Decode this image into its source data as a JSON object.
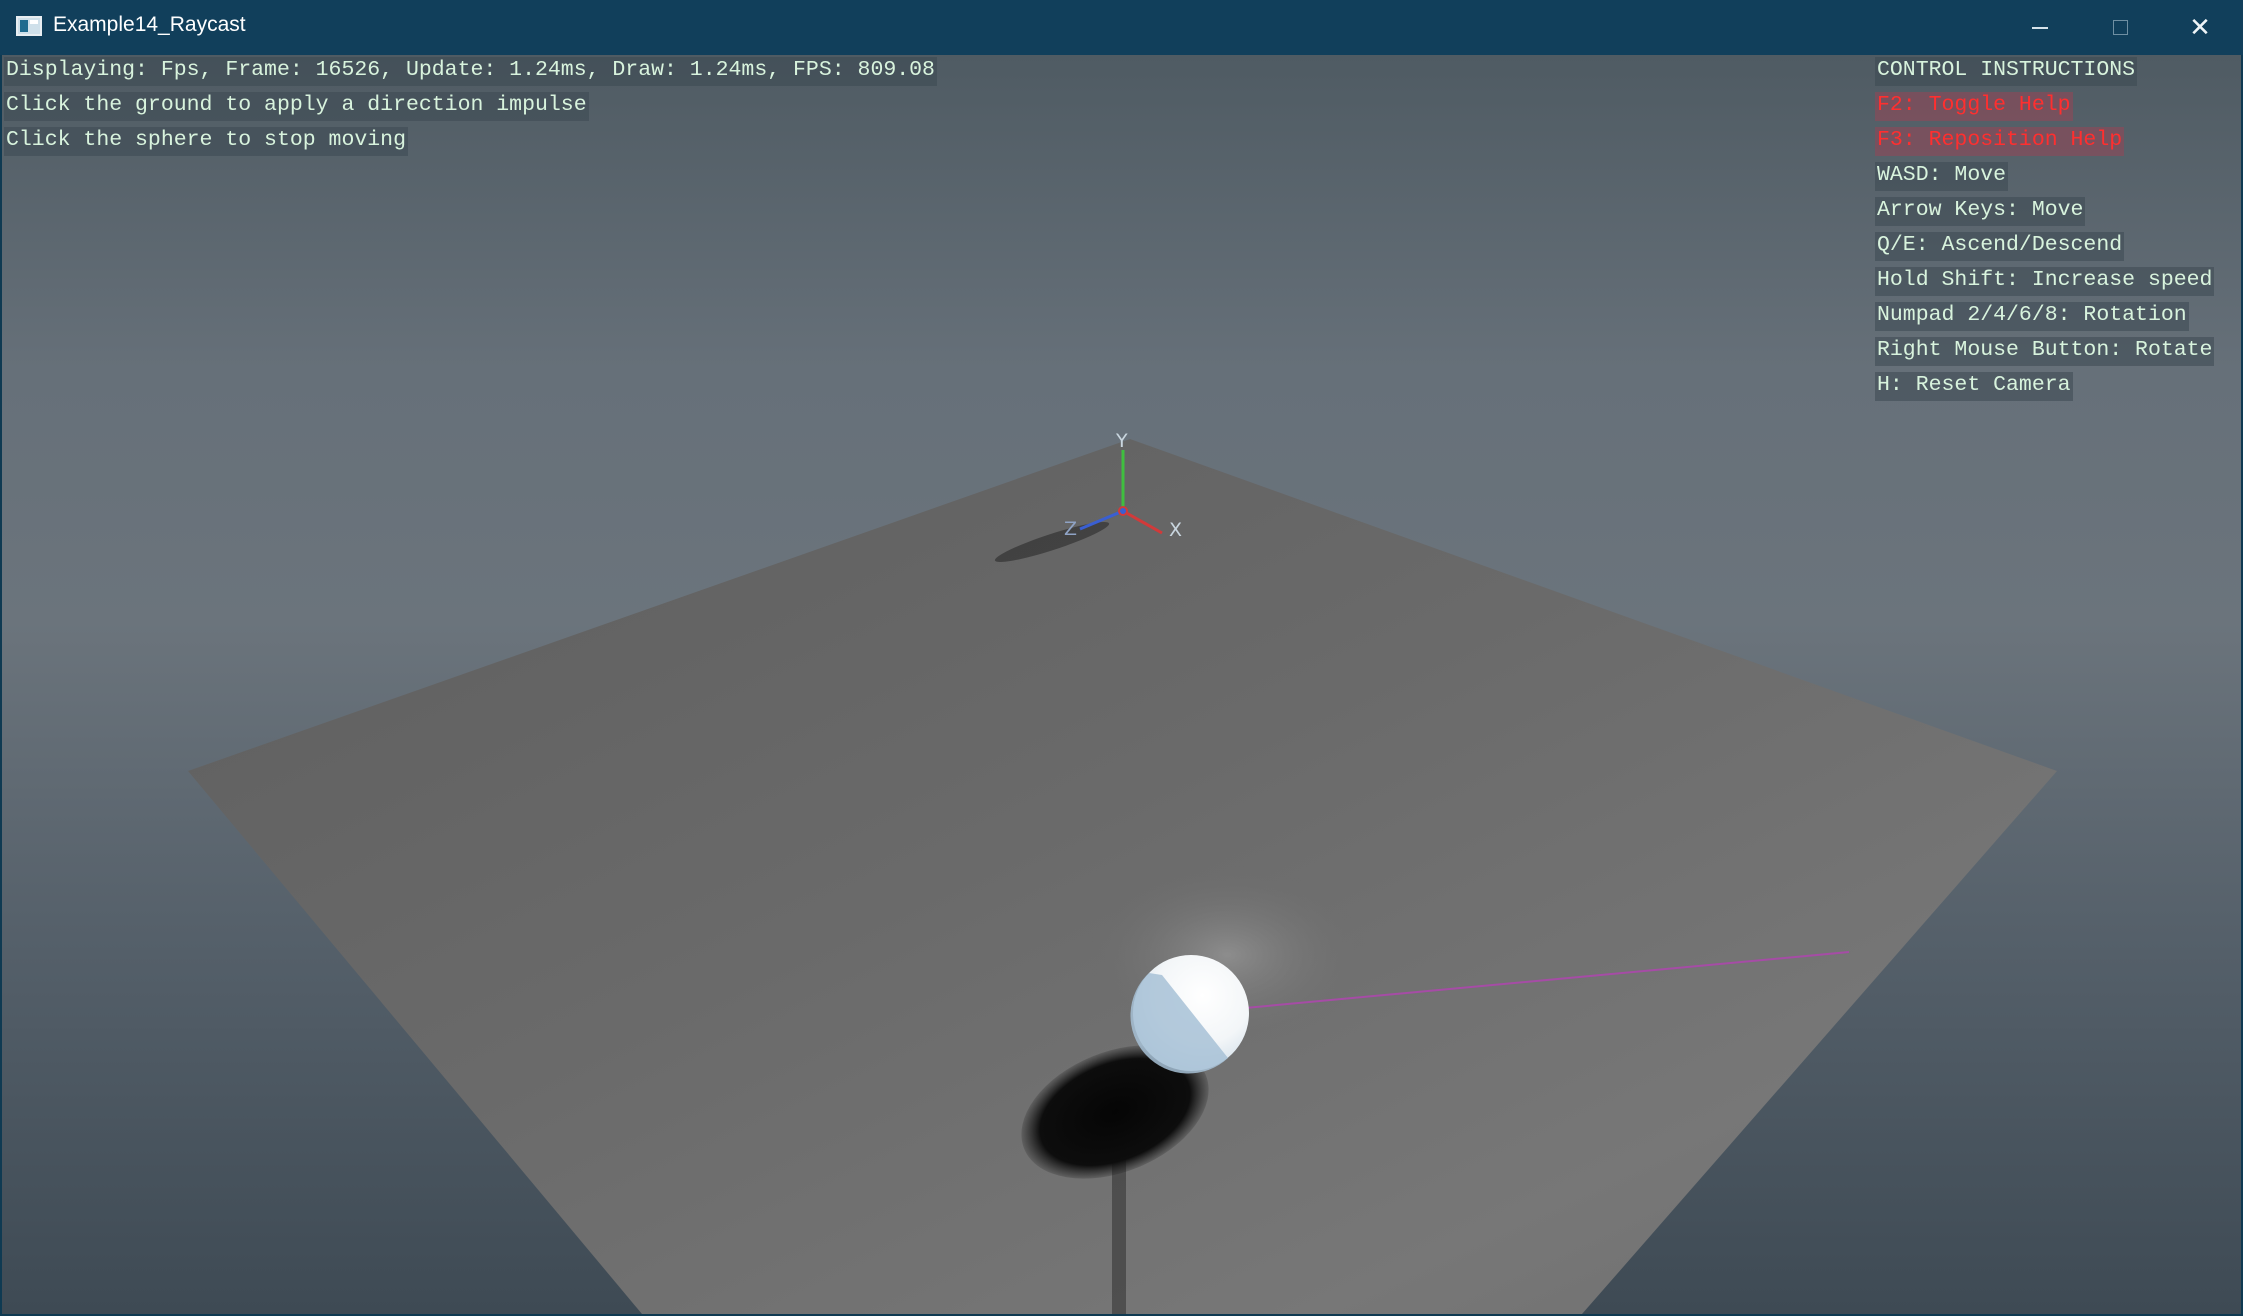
{
  "window": {
    "title": "Example14_Raycast",
    "controls": {
      "minimize": "minimize-icon",
      "maximize": "maximize-icon",
      "close": "close-icon"
    }
  },
  "stats": {
    "line": "Displaying: Fps, Frame: 16526, Update: 1.24ms, Draw: 1.24ms, FPS: 809.08"
  },
  "instructions_left": [
    "Click the ground to apply a direction impulse",
    "Click the sphere to stop moving"
  ],
  "help": {
    "title": "CONTROL INSTRUCTIONS",
    "items": [
      {
        "text": "F2: Toggle Help",
        "highlight": true
      },
      {
        "text": "F3: Reposition Help",
        "highlight": true
      },
      {
        "text": "WASD: Move",
        "highlight": false
      },
      {
        "text": "Arrow Keys: Move",
        "highlight": false
      },
      {
        "text": "Q/E: Ascend/Descend",
        "highlight": false
      },
      {
        "text": "Hold Shift: Increase speed",
        "highlight": false
      },
      {
        "text": "Numpad 2/4/6/8: Rotation",
        "highlight": false
      },
      {
        "text": "Right Mouse Button: Rotate",
        "highlight": false
      },
      {
        "text": "H: Reset Camera",
        "highlight": false
      }
    ]
  },
  "gizmo": {
    "y": "Y",
    "x": "X",
    "z": "Z"
  },
  "colors": {
    "titlebar": "#113f5b",
    "hud_text": "#d8f3dd",
    "hud_highlight": "#ff2f2f",
    "ray": "#a64ca6",
    "axis_x": "#d23a3a",
    "axis_y": "#3fbf3f",
    "axis_z": "#3a5fd2"
  }
}
